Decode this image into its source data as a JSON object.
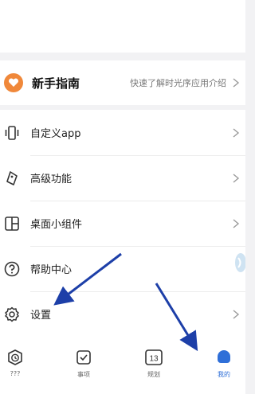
{
  "guide": {
    "title": "新手指南",
    "subtitle": "快速了解时光序应用介绍"
  },
  "menu": [
    {
      "label": "自定义app",
      "icon": "phone-vibrate-icon"
    },
    {
      "label": "高级功能",
      "icon": "tag-icon"
    },
    {
      "label": "桌面小组件",
      "icon": "widget-grid-icon"
    },
    {
      "label": "帮助中心",
      "icon": "help-circle-icon"
    },
    {
      "label": "设置",
      "icon": "gear-icon"
    }
  ],
  "tabs": [
    {
      "label": "???",
      "icon": "timer-icon"
    },
    {
      "label": "事项",
      "icon": "checkbox-icon"
    },
    {
      "label": "规划",
      "icon": "calendar-icon",
      "number": "13"
    },
    {
      "label": "我的",
      "icon": "profile-icon"
    }
  ],
  "colors": {
    "accent": "#2f6fd8",
    "guide_icon": "#f0883a",
    "annotation_arrow": "#1d3fa8"
  }
}
